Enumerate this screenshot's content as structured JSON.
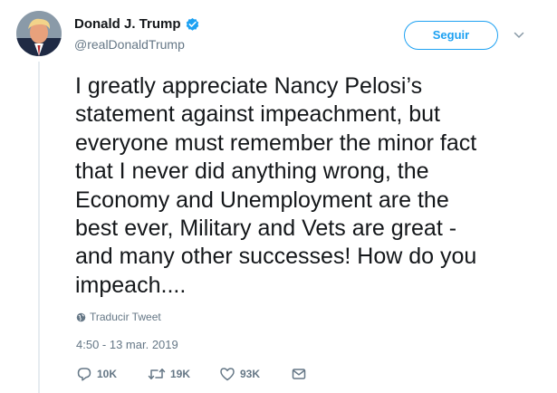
{
  "user": {
    "display_name": "Donald J. Trump",
    "handle": "@realDonaldTrump",
    "verified_icon": "verified-badge-icon"
  },
  "follow_button": {
    "label": "Seguir"
  },
  "tweet": {
    "text_lines": [
      "I greatly appreciate Nancy Pelosi’s",
      "statement against impeachment, but",
      "everyone must remember the minor fact",
      "that I never did anything wrong, the",
      "Economy and Unemployment are the",
      "best ever, Military and Vets are great -",
      "and many other successes! How do you",
      "impeach...."
    ],
    "translate_label": "Traducir Tweet",
    "timestamp": "4:50 - 13 mar. 2019"
  },
  "actions": {
    "reply_count": "10K",
    "retweet_count": "19K",
    "like_count": "93K"
  },
  "colors": {
    "accent": "#1da1f2",
    "secondary_text": "#657786",
    "primary_text": "#14171a",
    "thread_line": "#e6ecf0"
  }
}
